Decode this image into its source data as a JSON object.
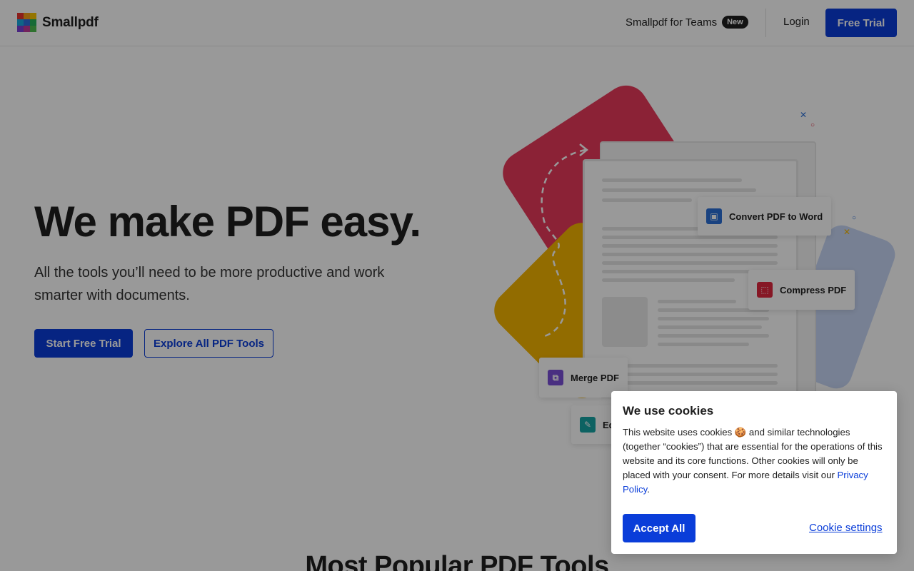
{
  "header": {
    "brand": "Smallpdf",
    "teams_label": "Smallpdf for Teams",
    "teams_badge": "New",
    "login_label": "Login",
    "free_trial_label": "Free Trial"
  },
  "hero": {
    "title": "We make PDF easy.",
    "subtitle": "All the tools you’ll need to be more productive and work smarter with documents.",
    "primary_cta": "Start Free Trial",
    "secondary_cta": "Explore All PDF Tools"
  },
  "illustration": {
    "tools": [
      {
        "label": "Convert PDF to Word",
        "icon": "word-icon",
        "color": "#2b6fd6"
      },
      {
        "label": "Compress PDF",
        "icon": "compress-icon",
        "color": "#e0273f"
      },
      {
        "label": "Merge PDF",
        "icon": "merge-icon",
        "color": "#7b4fd8"
      },
      {
        "label": "Ed",
        "icon": "edit-icon",
        "color": "#16a3a3"
      }
    ]
  },
  "section": {
    "title": "Most Popular PDF Tools"
  },
  "cookie_banner": {
    "title": "We use cookies",
    "text_before_link": "This website uses cookies 🍪 and similar technologies (together “cookies”) that are essential for the operations of this website and its core functions. Other cookies will only be placed with your consent. For more details visit our ",
    "link_label": "Privacy Policy",
    "text_after_link": ".",
    "accept_label": "Accept All",
    "settings_label": "Cookie settings"
  },
  "colors": {
    "brand_blue": "#0a3dd9",
    "overlay": "rgba(0,0,0,0.40)"
  }
}
